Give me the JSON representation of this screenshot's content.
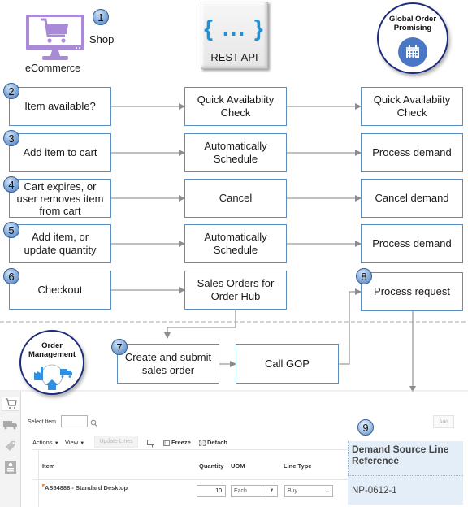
{
  "top": {
    "ecommerce": {
      "label": "eCommerce",
      "icon": "monitor-cart-icon",
      "color": "#a98ad6"
    },
    "shop": {
      "step": "1",
      "label": "Shop"
    },
    "rest_api": {
      "braces": "{ ... }",
      "label": "REST API",
      "brace_color": "#1e90d6"
    },
    "gop": {
      "title_line1": "Global Order",
      "title_line2": "Promising",
      "icon": "calendar-icon"
    }
  },
  "rows": [
    {
      "step": "2",
      "left": "Item available?",
      "middle": "Quick Availabiity\nCheck",
      "right": "Quick Availabiity\nCheck"
    },
    {
      "step": "3",
      "left": "Add item to cart",
      "middle": "Automatically\nSchedule",
      "right": "Process demand"
    },
    {
      "step": "4",
      "left": "Cart expires, or\nuser removes  item\nfrom cart",
      "middle": "Cancel",
      "right": "Cancel demand"
    },
    {
      "step": "5",
      "left": "Add item, or\nupdate quantity",
      "middle": "Automatically\nSchedule",
      "right": "Process demand"
    },
    {
      "step": "6",
      "left": "Checkout",
      "middle": "Sales Orders for\nOrder Hub",
      "right": "Process request",
      "right_step": "8"
    }
  ],
  "order_management": {
    "title_line1": "Order",
    "title_line2": "Management",
    "step": "7",
    "create_box": "Create and submit\nsales order",
    "call_box": "Call GOP"
  },
  "app": {
    "select_item_label": "Select Item",
    "select_item_value": "",
    "add_button": "Add",
    "toolbar": {
      "actions": "Actions",
      "view": "View",
      "update_lines": "Update Lines",
      "freeze": "Freeze",
      "detach": "Detach"
    },
    "columns": [
      "Item",
      "Quantity",
      "UOM",
      "Line Type"
    ],
    "rows": [
      {
        "item": "AS54888 - Standard Desktop",
        "quantity": "10",
        "uom": "Each",
        "line_type": "Buy"
      }
    ],
    "demand_source": {
      "step": "9",
      "header": "Demand Source Line Reference",
      "value": "NP-0612-1"
    }
  }
}
